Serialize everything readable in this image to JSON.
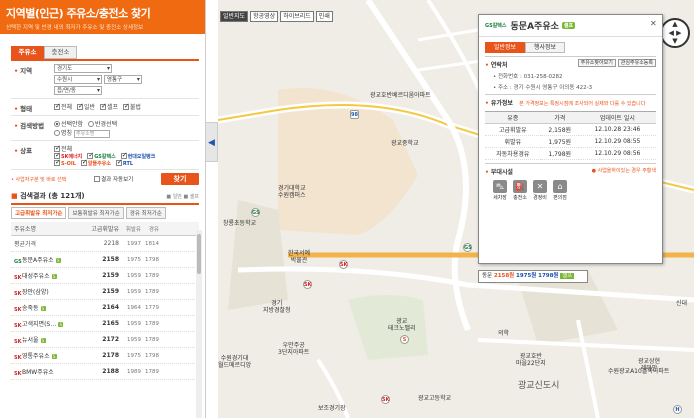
{
  "header": {
    "title": "지역별(인근) 주유소/충전소 찾기",
    "subtitle": "선택한 지역 및 반경 내의 최저가 주유소 및 충전소 상세정보"
  },
  "tabs": [
    {
      "label": "주유소"
    },
    {
      "label": "충전소"
    }
  ],
  "form": {
    "region_label": "지역",
    "sido": "경기도",
    "sigungu": "수원시",
    "gu": "영통구",
    "dong": "읍/면/동",
    "type_label": "형태",
    "type_opts": [
      "전체",
      "일반",
      "셀프",
      "불법"
    ],
    "method_label": "검색방법",
    "method_opts": [
      "선택안함",
      "반경선택"
    ],
    "name_label": "명칭",
    "name_placeholder": "주유소명",
    "brand_label": "상표",
    "brand_all": "전체",
    "brands": [
      "SK에너지",
      "GS칼텍스",
      "현대오일뱅크",
      "S-OIL",
      "알뜰주유소",
      "RTL"
    ],
    "note": "• 사업자구분 및 바로 선택",
    "auto_label": "결과 자동보기",
    "search_button": "찾기"
  },
  "results": {
    "title": "검색결과",
    "count": "(총 121개)",
    "legend": "■ 일반 ■ 셀프",
    "sort_tabs": [
      "고급휘발유 최저가순",
      "보통휘발유 최저가순",
      "경유 최저가순"
    ],
    "headers": [
      "주유소명",
      "고급휘발유",
      "휘발유",
      "경유"
    ],
    "avg_row": {
      "name": "평균가격",
      "premium": "2218",
      "gas": "1997",
      "diesel": "1814"
    },
    "rows": [
      {
        "brand": "GS",
        "name": "동문A주유소",
        "self": "S",
        "premium": "2158",
        "gas": "1975",
        "diesel": "1798",
        "color": "#1a7e3c"
      },
      {
        "brand": "SK",
        "name": "대성주유소",
        "self": "S",
        "premium": "2159",
        "gas": "1959",
        "diesel": "1789",
        "color": "#d92020"
      },
      {
        "brand": "SK",
        "name": "장안(삼양)",
        "self": "",
        "premium": "2159",
        "gas": "1959",
        "diesel": "1789",
        "color": "#d92020"
      },
      {
        "brand": "SK",
        "name": "송죽동",
        "self": "S",
        "premium": "2164",
        "gas": "1964",
        "diesel": "1779",
        "color": "#d92020"
      },
      {
        "brand": "SK",
        "name": "고색지면(S…",
        "self": "S",
        "premium": "2165",
        "gas": "1959",
        "diesel": "1789",
        "color": "#d92020"
      },
      {
        "brand": "SK",
        "name": "뉴서울",
        "self": "S",
        "premium": "2172",
        "gas": "1959",
        "diesel": "1789",
        "color": "#d92020"
      },
      {
        "brand": "SK",
        "name": "영통주유소",
        "self": "S",
        "premium": "2178",
        "gas": "1975",
        "diesel": "1798",
        "color": "#d92020"
      },
      {
        "brand": "SK",
        "name": "BMW주유소",
        "self": "",
        "premium": "2188",
        "gas": "1989",
        "diesel": "1789",
        "color": "#d92020"
      }
    ]
  },
  "map": {
    "buttons": [
      "일반지도",
      "항공영상",
      "하이브리드",
      "인쇄"
    ],
    "labels": [
      {
        "text": "광교호반베르디움아파트"
      },
      {
        "text": "광교중학교"
      },
      {
        "text": "경기대학교\n수원캠퍼스"
      },
      {
        "text": "창룡초등학교"
      },
      {
        "text": "한국서예\n박물관"
      },
      {
        "text": "경기\n지방경찰청"
      },
      {
        "text": "광교\n테크노밸리"
      },
      {
        "text": "우만주공\n3단지아파트"
      },
      {
        "text": "수원경기대\n월드메르디앙"
      },
      {
        "text": "광교신도시"
      },
      {
        "text": "광교고등학교"
      },
      {
        "text": "광교호반\n마을22단지"
      },
      {
        "text": "광교상현\n레미안"
      },
      {
        "text": "수원광교A10블록아파트"
      },
      {
        "text": "보조경기장"
      },
      {
        "text": "의학"
      },
      {
        "text": "신대"
      }
    ]
  },
  "popup": {
    "brand": "GS칼텍스",
    "name": "동문A주유소",
    "self_badge": "셀프",
    "tabs": [
      "일반정보",
      "행사정보"
    ],
    "contact_title": "연락처",
    "contact_buttons": [
      "주유소찾아보기",
      "관심주유소등록"
    ],
    "phone_label": "• 전화번호 :",
    "phone": "031-258-0282",
    "address_label": "• 주소 :",
    "address": "경기 수원시 영통구 이의동 422-3",
    "price_title": "유가정보",
    "price_note": "본 가격정보는 특정시점에 조사되어 실제와 다를 수 있습니다",
    "price_headers": [
      "유종",
      "가격",
      "업데이트 일시"
    ],
    "prices": [
      {
        "type": "고급휘발유",
        "price": "2,158원",
        "updated": "12.10.28 23:46"
      },
      {
        "type": "휘발유",
        "price": "1,975원",
        "updated": "12.10.29 08:55"
      },
      {
        "type": "자동차용경유",
        "price": "1,798원",
        "updated": "12.10.29 08:56"
      }
    ],
    "facility_title": "부대시설",
    "facility_note": "● 사업을하이있는 경우 주황색",
    "facilities": [
      "세차장",
      "충전소",
      "경정비",
      "편의점"
    ],
    "bottom": {
      "label": "동문",
      "premium": "2158원",
      "gas": "1975원",
      "diesel": "1798원",
      "self": "셀프"
    }
  }
}
